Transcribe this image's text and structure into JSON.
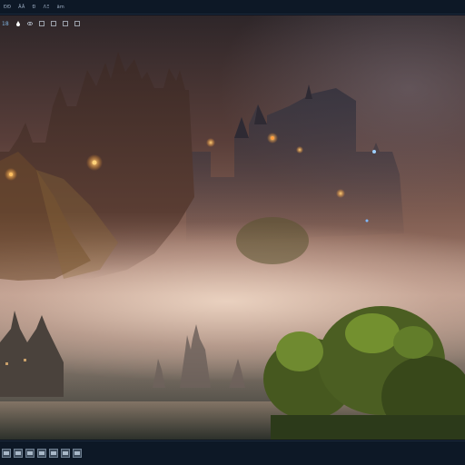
{
  "menu": {
    "items": [
      {
        "label": "ÐÐ"
      },
      {
        "label": "ÂÂ"
      },
      {
        "label": "Ð"
      },
      {
        "label": "ΛΞ"
      },
      {
        "label": "ãm"
      }
    ]
  },
  "canvas": {
    "zoom_label": "18",
    "tools": [
      "drop-icon",
      "eye-icon",
      "square-icon",
      "square-icon",
      "square-icon",
      "square-icon"
    ],
    "image_description_colors": {
      "sky": "#2e2629",
      "castle": "#3a2a26",
      "mist": "#e6d2c4",
      "tree": "#5f7a2a",
      "window_light": "#ffb347"
    }
  },
  "bottom_toolbar": {
    "thumbnails": [
      "frame-1",
      "frame-2",
      "frame-3",
      "frame-4",
      "frame-5",
      "frame-6",
      "frame-7"
    ]
  }
}
